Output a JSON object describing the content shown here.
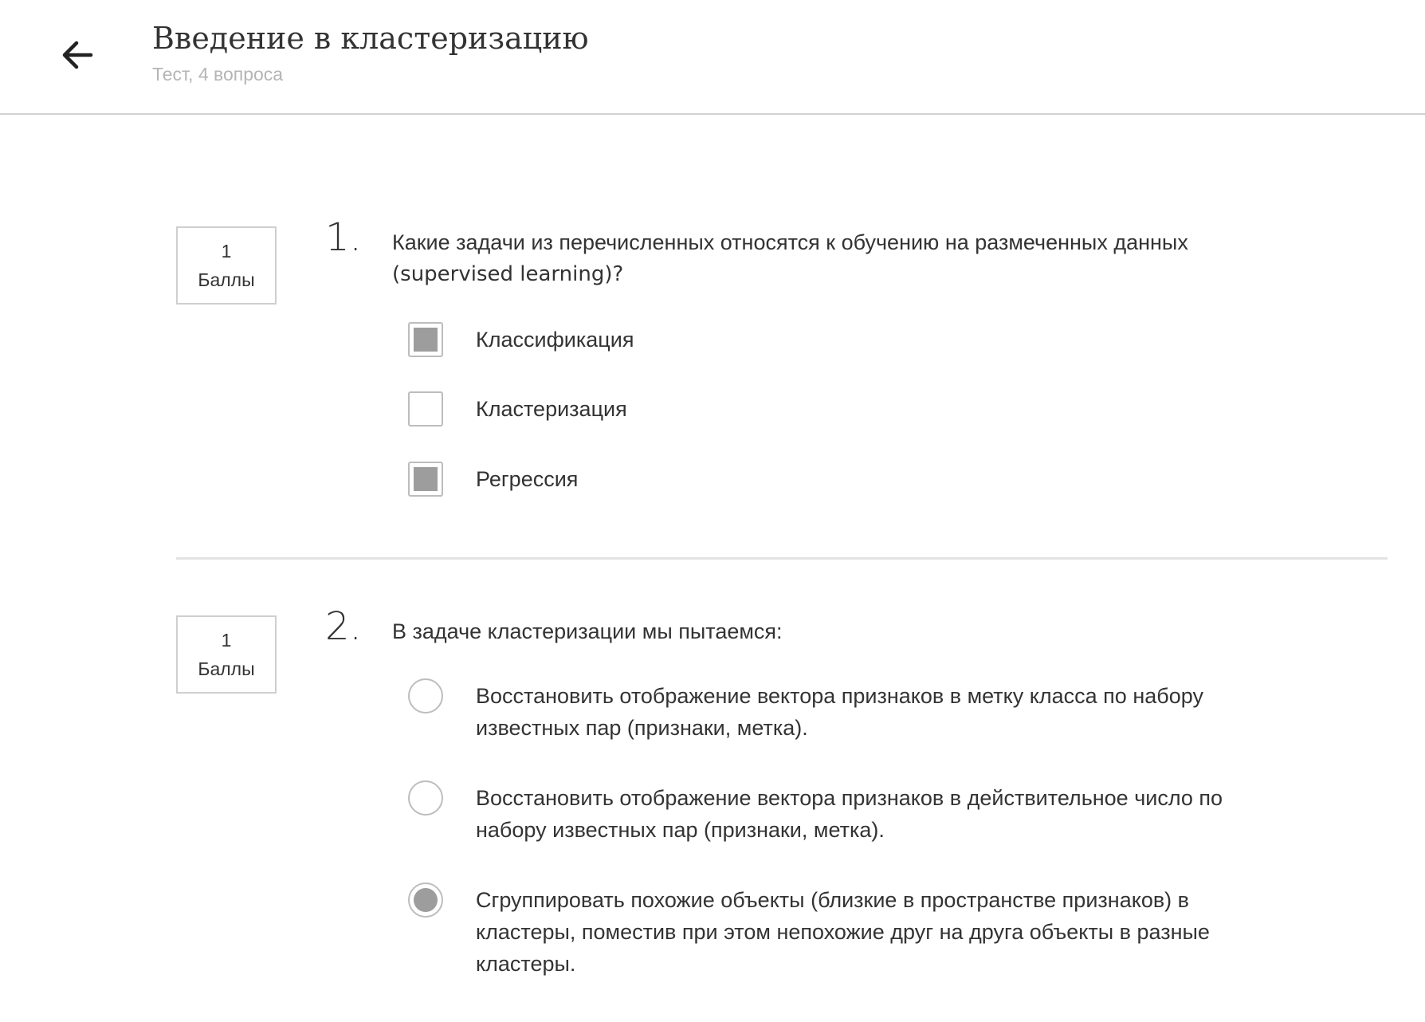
{
  "header": {
    "title": "Введение в кластеризацию",
    "subtitle": "Тест, 4 вопроса",
    "back_icon": "arrow-left-icon"
  },
  "questions": [
    {
      "points_value": "1",
      "points_label": "Баллы",
      "number": "1.",
      "text_line1": "Какие задачи из перечисленных относятся к обучению на размеченных данных",
      "text_line2": "(supervised learning)?",
      "type": "checkbox",
      "options": [
        {
          "label": "Классификация",
          "checked": true
        },
        {
          "label": "Кластеризация",
          "checked": false
        },
        {
          "label": "Регрессия",
          "checked": true
        }
      ]
    },
    {
      "points_value": "1",
      "points_label": "Баллы",
      "number": "2.",
      "text": "В задаче кластеризации мы пытаемся:",
      "type": "radio",
      "options": [
        {
          "line1": "Восстановить отображение вектора признаков в метку класса по набору",
          "line2": "известных пар (признаки, метка).",
          "checked": false
        },
        {
          "line1": "Восстановить отображение вектора признаков в действительное число по",
          "line2": "набору известных пар (признаки, метка).",
          "checked": false
        },
        {
          "line1": "Сгруппировать похожие объекты (близкие в пространстве признаков) в",
          "line2": "кластеры, поместив при этом непохожие друг на друга объекты в разные",
          "line3": "кластеры.",
          "checked": true
        }
      ]
    }
  ],
  "colors": {
    "text": "#333333",
    "muted": "#b5b5b5",
    "selected_fill": "#9d9d9d",
    "border": "#bdbdbd"
  }
}
